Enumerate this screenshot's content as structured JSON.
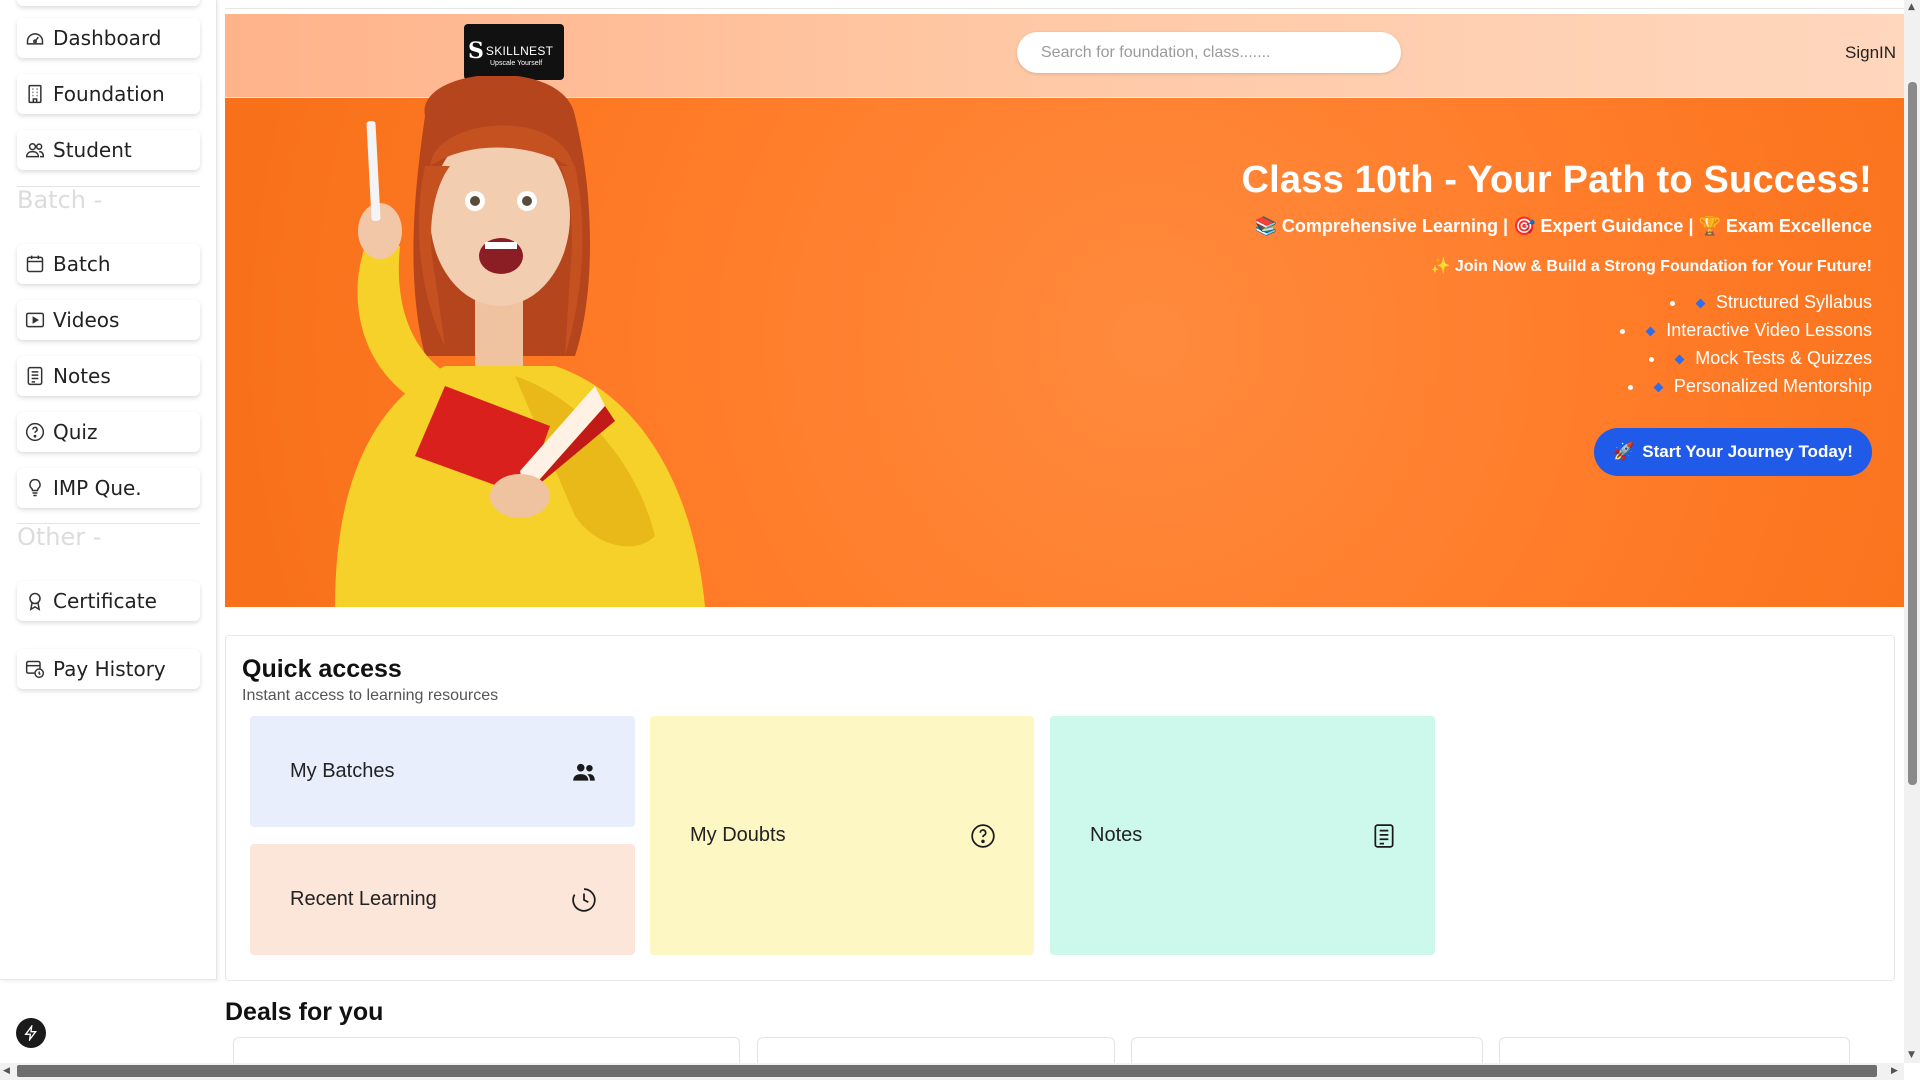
{
  "sidebar": {
    "items": [
      {
        "label": "Dashboard",
        "icon": "dashboard-icon"
      },
      {
        "label": "Foundation",
        "icon": "building-icon"
      },
      {
        "label": "Student",
        "icon": "users-icon"
      },
      {
        "label": "Batch",
        "icon": "calendar-icon"
      },
      {
        "label": "Videos",
        "icon": "video-icon"
      },
      {
        "label": "Notes",
        "icon": "notes-icon"
      },
      {
        "label": "Quiz",
        "icon": "question-icon"
      },
      {
        "label": "IMP Que.",
        "icon": "lightbulb-icon"
      },
      {
        "label": "Certificate",
        "icon": "award-icon"
      },
      {
        "label": "Pay History",
        "icon": "pay-history-icon"
      }
    ],
    "sections": {
      "batch": "Batch -",
      "other": "Other -"
    }
  },
  "header": {
    "logo_name": "SKILLNEST",
    "logo_tagline": "Upscale Yourself",
    "search_placeholder": "Search for foundation, class.......",
    "signin": "SignIN"
  },
  "hero": {
    "title": "Class 10th - Your Path to Success!",
    "tags": "📚 Comprehensive Learning | 🎯 Expert Guidance | 🏆 Exam Excellence",
    "join": "✨ Join Now & Build a Strong Foundation for Your Future!",
    "features": [
      "Structured Syllabus",
      "Interactive Video Lessons",
      "Mock Tests & Quizzes",
      "Personalized Mentorship"
    ],
    "cta": "Start Your Journey Today!",
    "colors": {
      "orange": "#ff7a26",
      "cta_blue": "#1f5ae8"
    }
  },
  "quick_access": {
    "title": "Quick access",
    "subtitle": "Instant access to learning resources",
    "cards": [
      {
        "label": "My Batches",
        "icon": "users-icon",
        "color": "#e8eefc"
      },
      {
        "label": "Recent Learning",
        "icon": "clock-icon",
        "color": "#fbe6d9"
      },
      {
        "label": "My Doubts",
        "icon": "question-circle-icon",
        "color": "#fdf7c4"
      },
      {
        "label": "Notes",
        "icon": "notes-icon",
        "color": "#cdf8ec"
      }
    ]
  },
  "deals": {
    "title": "Deals for you"
  }
}
